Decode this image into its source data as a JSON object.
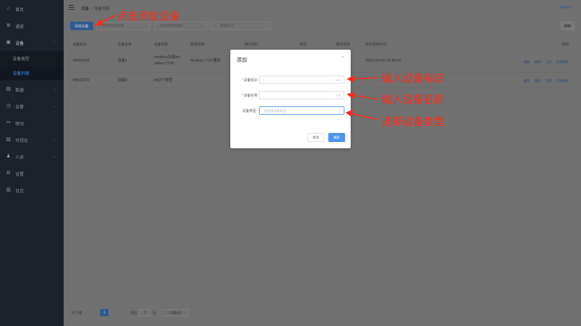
{
  "sidebar": {
    "items": [
      {
        "label": "首页",
        "icon": "home-icon",
        "glyph": "⌂"
      },
      {
        "label": "通道",
        "icon": "channel-icon",
        "glyph": "⋓"
      },
      {
        "label": "设备",
        "icon": "device-icon",
        "glyph": "▣",
        "chevron": "⌃"
      },
      {
        "label": "数据",
        "icon": "data-icon",
        "glyph": "▤",
        "chevron": "⌄"
      },
      {
        "label": "告警",
        "icon": "alarm-icon",
        "glyph": "◷",
        "chevron": "⌄"
      },
      {
        "label": "联动",
        "icon": "link-icon",
        "glyph": "⚯"
      },
      {
        "label": "可视化",
        "icon": "visual-icon",
        "glyph": "▨",
        "chevron": "⌄"
      },
      {
        "label": "人员",
        "icon": "user-icon",
        "glyph": "♟",
        "chevron": "⌄"
      },
      {
        "label": "设置",
        "icon": "settings-icon",
        "glyph": "⚙"
      },
      {
        "label": "日志",
        "icon": "log-icon",
        "glyph": "▥"
      }
    ],
    "sub_items": [
      {
        "label": "设备类型"
      },
      {
        "label": "设备列表"
      }
    ]
  },
  "header": {
    "breadcrumb": [
      "设备",
      "设备列表"
    ],
    "separator": "/",
    "user": "admin"
  },
  "toolbar": {
    "add_label": "添加设备",
    "device_type_placeholder": "请选择设备类型",
    "data_template_placeholder": "请选择数据通道",
    "search_placeholder": "搜索标识",
    "refresh_label": "刷新"
  },
  "table": {
    "columns": [
      "设备标识",
      "设备名称",
      "设备类型",
      "数据通道",
      "通讯规约",
      "地址",
      "通讯状态",
      "状态更新时间",
      "操作"
    ],
    "rows": [
      {
        "id": "W002568",
        "name": "设备1",
        "type_line1": "modbus设备(m",
        "type_line2": "odbus TCP)",
        "channel": "Modbus TCP通道",
        "time": "2021-04-02 16:45:16",
        "ops": [
          "编辑",
          "删除",
          "显示",
          "实时数据"
        ]
      },
      {
        "id": "W002570",
        "name": "设备2",
        "type_line1": "MQTT类型",
        "type_line2": "",
        "channel": "",
        "time": "",
        "ops": [
          "编辑",
          "删除",
          "显示",
          "实时数据"
        ]
      }
    ]
  },
  "pagination": {
    "total": "共 2 条",
    "prev": "‹",
    "current": "1",
    "next": "›",
    "goto_label": "前往",
    "goto_value": "1",
    "page_unit": "页",
    "page_size": "10条/页"
  },
  "dialog": {
    "title": "添加",
    "close": "×",
    "fields": [
      {
        "label": "设备标识",
        "required": "*",
        "count": "0/20"
      },
      {
        "label": "设备名称",
        "required": "*",
        "count": "0/20"
      },
      {
        "label": "设备类型",
        "placeholder": "请选择设备类型",
        "arrow": "⌄"
      }
    ],
    "cancel_label": "取消",
    "ok_label": "确定"
  },
  "annotations": [
    {
      "text": "点击添加设备"
    },
    {
      "text": "输入设备标识"
    },
    {
      "text": "输入设备名称"
    },
    {
      "text": "选择设备类型"
    }
  ],
  "colors": {
    "sidebar_bg": "#1c222b",
    "accent": "#4f93ef",
    "annotation": "#ff2a1a",
    "overlay": "#707070"
  }
}
